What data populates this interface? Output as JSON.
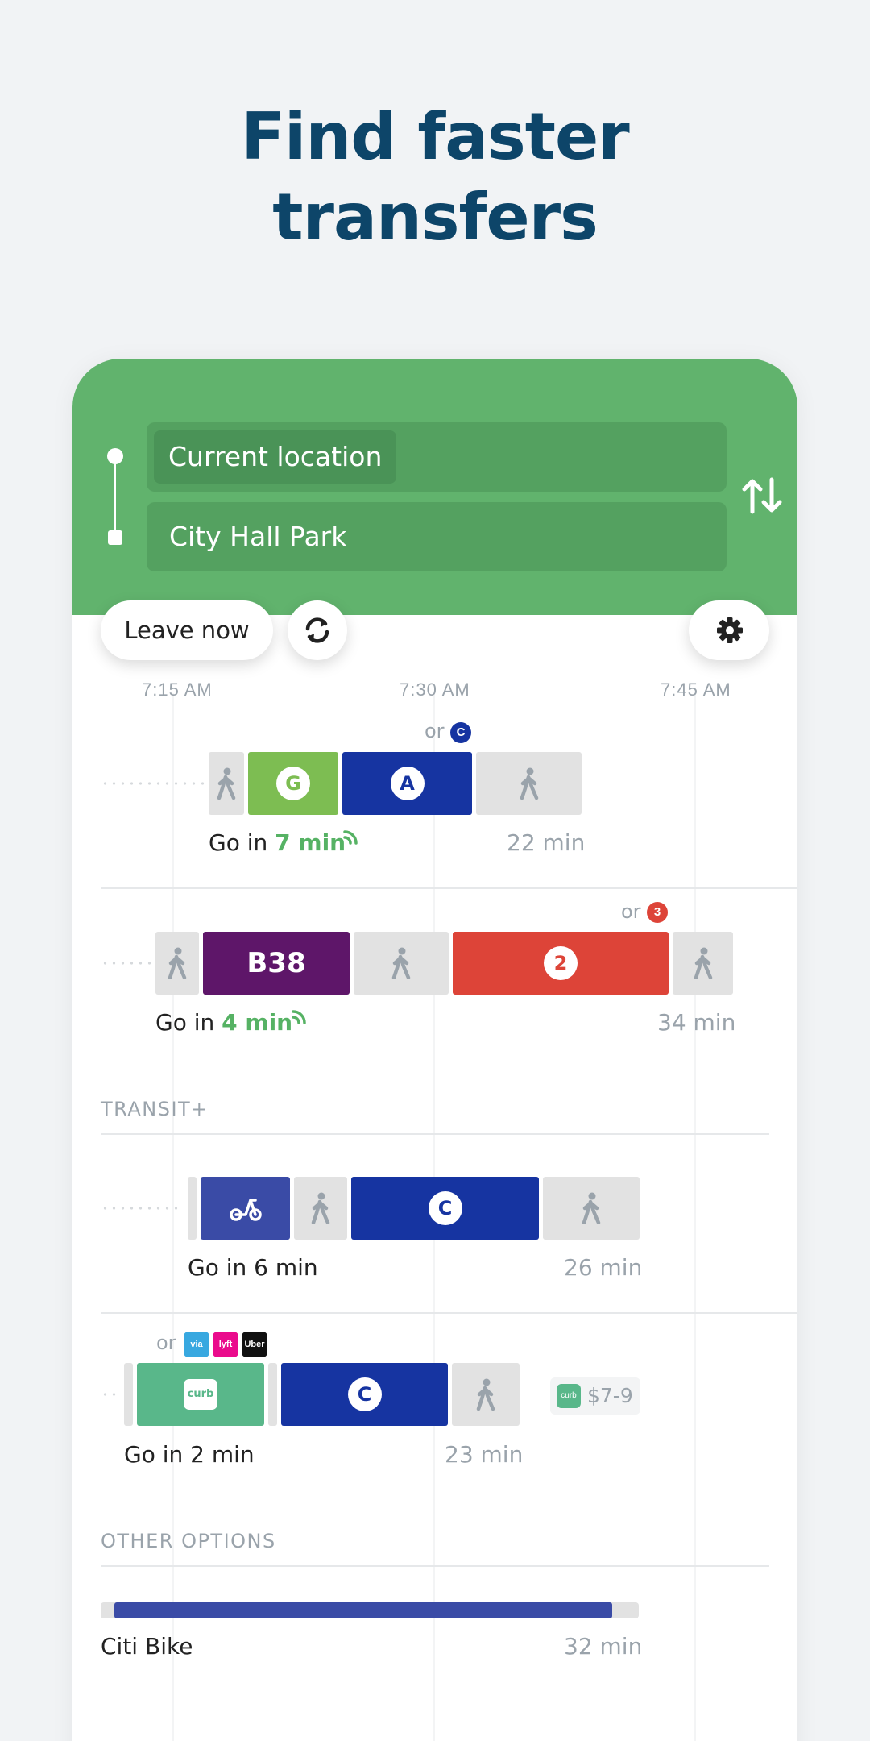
{
  "headline": {
    "line1": "Find faster",
    "line2": "transfers"
  },
  "search": {
    "origin": "Current location",
    "destination": "City Hall Park"
  },
  "controls": {
    "leave_label": "Leave now"
  },
  "timeline": {
    "t1": "7:15 AM",
    "t2": "7:30 AM",
    "t3": "7:45 AM"
  },
  "colors": {
    "green": "#61b36d",
    "g_train": "#7dbd52",
    "a_train": "#1634a1",
    "b38_bus": "#5e1669",
    "two_train": "#dd4438",
    "citi_bike": "#3a4ba6",
    "curb": "#59b78a",
    "walk": "#e2e2e2",
    "headline": "#0d4569"
  },
  "trip1": {
    "or_label": "or",
    "alt_route": "C",
    "route_g": "G",
    "route_a": "A",
    "go_prefix": "Go in",
    "go_time": "7 min",
    "duration": "22 min"
  },
  "trip2": {
    "or_label": "or",
    "alt_route": "3",
    "route_bus": "B38",
    "route_2": "2",
    "go_prefix": "Go in",
    "go_time": "4 min",
    "duration": "34 min"
  },
  "transit_plus": {
    "header": "TRANSIT+"
  },
  "trip3": {
    "route_c": "C",
    "go_text": "Go in 6 min",
    "duration": "26 min",
    "bike_icon": "scooter-icon"
  },
  "trip4": {
    "or_label": "or",
    "apps": {
      "via": "via",
      "lyft": "lyft",
      "uber": "Uber"
    },
    "curb_label": "curb",
    "route_c": "C",
    "go_text": "Go in 2 min",
    "duration": "23 min",
    "price": "$7-9"
  },
  "other_options": {
    "header": "OTHER OPTIONS"
  },
  "citi_bike": {
    "label": "Citi Bike",
    "duration": "32 min",
    "progress": 0.95
  }
}
